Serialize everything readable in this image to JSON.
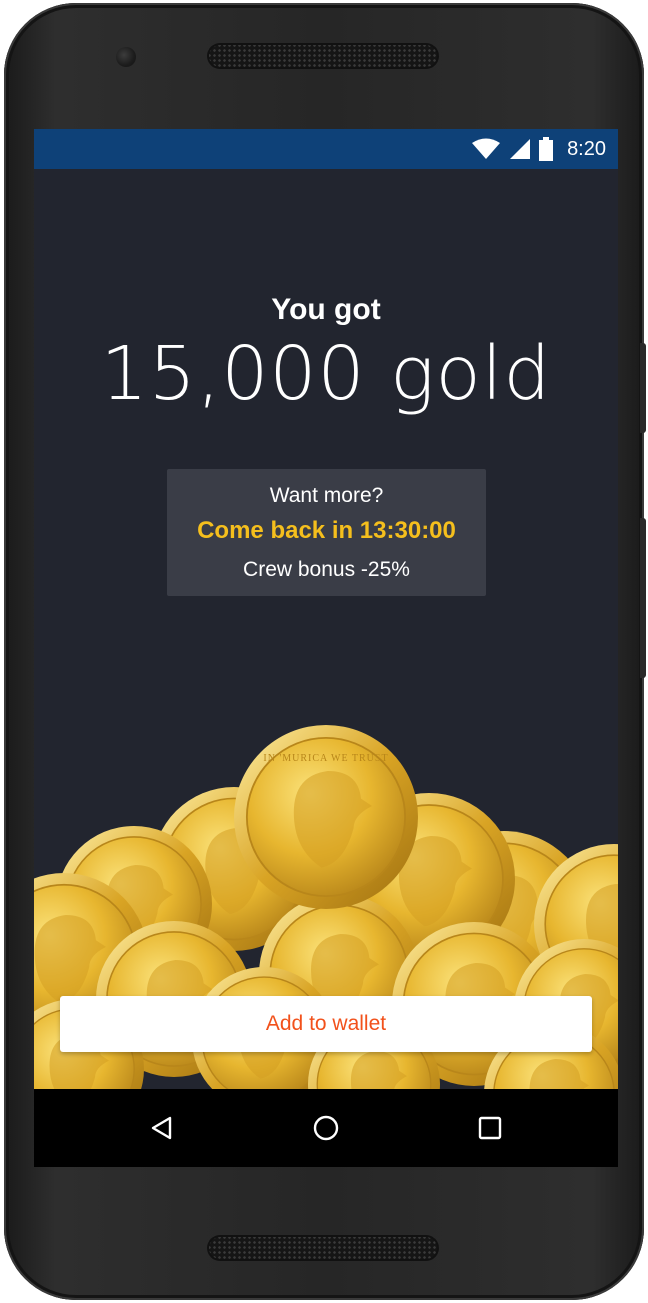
{
  "status_bar": {
    "time": "8:20",
    "icons": [
      "wifi-icon",
      "cell-signal-icon",
      "battery-icon"
    ],
    "color": "#0e4178"
  },
  "reward": {
    "heading": "You got",
    "amount": "15,000 gold"
  },
  "info": {
    "prompt": "Want more?",
    "countdown": "Come back in 13:30:00",
    "bonus": "Crew bonus -25%",
    "accent_color": "#f5bf1d"
  },
  "coin_inscription": "IN 'MURICA WE TRUST",
  "actions": {
    "add_to_wallet": "Add to wallet",
    "accent_color": "#f2511b"
  },
  "nav_bar": {
    "items": [
      "back-icon",
      "home-icon",
      "recents-icon"
    ]
  },
  "theme": {
    "background": "#22252f",
    "panel": "#3a3d47"
  }
}
